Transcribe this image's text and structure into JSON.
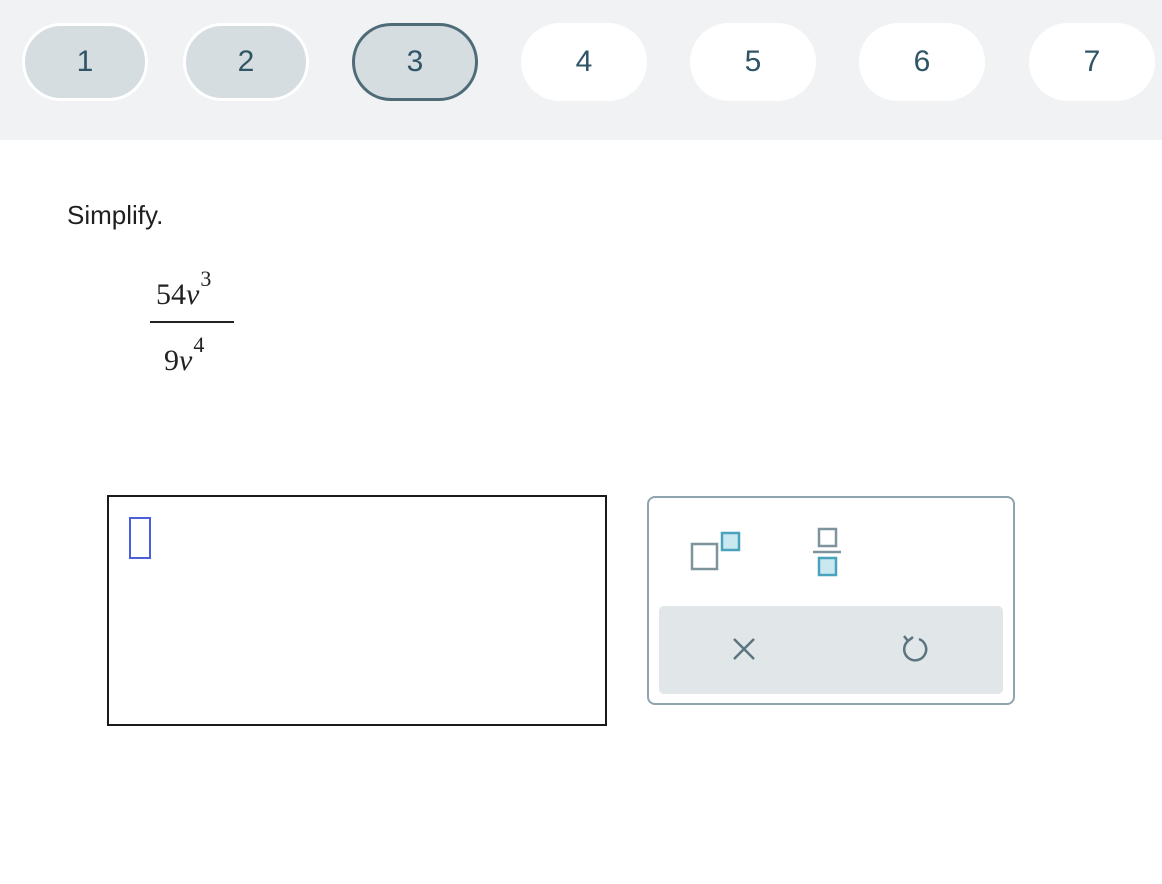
{
  "nav": {
    "questions": [
      {
        "label": "1",
        "state": "done"
      },
      {
        "label": "2",
        "state": "done"
      },
      {
        "label": "3",
        "state": "current"
      },
      {
        "label": "4",
        "state": "todo"
      },
      {
        "label": "5",
        "state": "todo"
      },
      {
        "label": "6",
        "state": "todo"
      },
      {
        "label": "7",
        "state": "todo"
      }
    ]
  },
  "problem": {
    "instruction": "Simplify.",
    "numerator": {
      "coefficient": "54",
      "variable": "v",
      "exponent": "3"
    },
    "denominator": {
      "coefficient": "9",
      "variable": "v",
      "exponent": "4"
    }
  },
  "answer": {
    "value": ""
  },
  "keypad": {
    "buttons": [
      {
        "name": "superscript-icon"
      },
      {
        "name": "fraction-icon"
      },
      {
        "name": "clear-icon"
      },
      {
        "name": "undo-icon"
      }
    ]
  },
  "colors": {
    "nav_bar_bg": "#f0f2f4",
    "nav_done_bg": "#d5dde1",
    "nav_current_border": "#4f6b78",
    "nav_text": "#2f5566",
    "cursor_blue": "#4a5fe0",
    "keypad_accent": "#4aa3bd",
    "keypad_bottom_bg": "#e1e6e8"
  }
}
